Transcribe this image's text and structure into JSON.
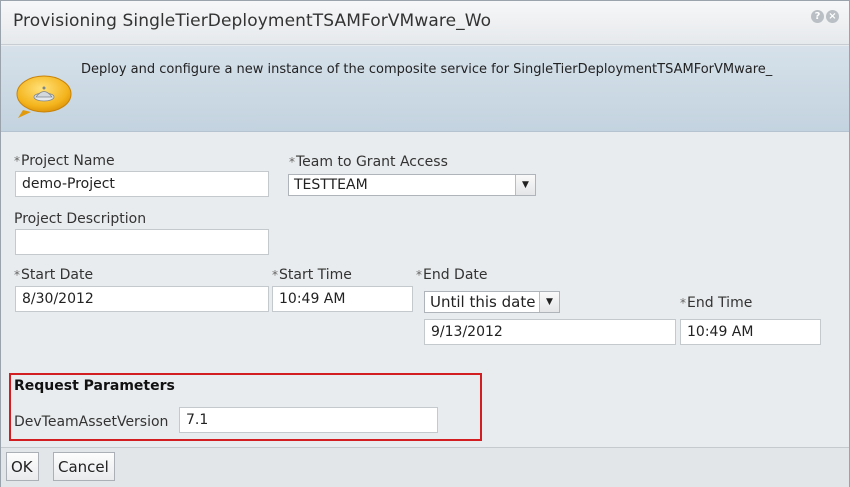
{
  "dialog": {
    "title": "Provisioning SingleTierDeploymentTSAMForVMware_Wo",
    "help_icon": "?",
    "close_icon": "×"
  },
  "banner": {
    "icon": "speech-bubble-icon",
    "description": "Deploy and configure a new instance of the composite service for SingleTierDeploymentTSAMForVMware_"
  },
  "form": {
    "required_marker": "*",
    "project_name": {
      "label": "Project Name",
      "value": "demo-Project"
    },
    "team": {
      "label": "Team to Grant Access",
      "value": "TESTTEAM"
    },
    "project_description": {
      "label": "Project Description",
      "value": ""
    },
    "start_date": {
      "label": "Start Date",
      "value": "8/30/2012"
    },
    "start_time": {
      "label": "Start Time",
      "value": "10:49 AM"
    },
    "end_date": {
      "label": "End Date",
      "mode": "Until this date",
      "value": "9/13/2012"
    },
    "end_time": {
      "label": "End Time",
      "value": "10:49 AM"
    }
  },
  "request_parameters": {
    "title": "Request Parameters",
    "dev_team_asset_version": {
      "label": "DevTeamAssetVersion",
      "value": "7.1"
    }
  },
  "buttons": {
    "ok": "OK",
    "cancel": "Cancel"
  },
  "colors": {
    "highlight_border": "#d21d21",
    "banner_bg": "#c9d7e2"
  }
}
